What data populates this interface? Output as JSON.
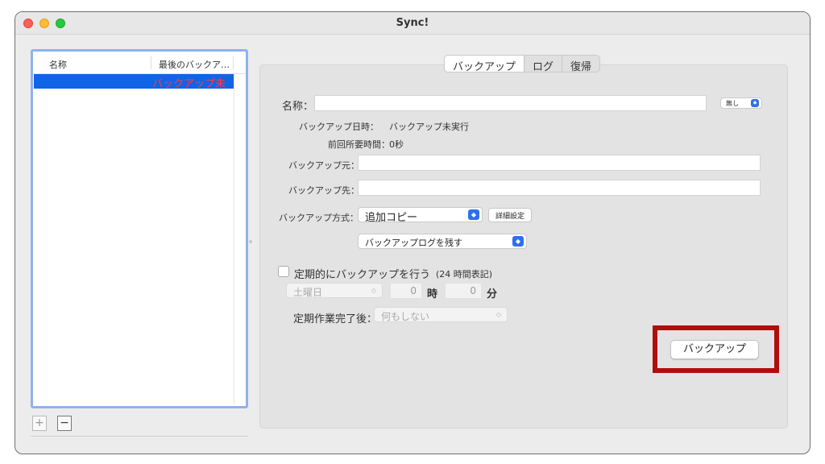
{
  "window": {
    "title": "Sync!"
  },
  "list": {
    "columns": [
      "名称",
      "最後のバックア…"
    ],
    "rows": [
      {
        "name": "",
        "status": "バックアップ未"
      }
    ],
    "add_label": "+",
    "remove_label": "−"
  },
  "tabs": [
    "バックアップ",
    "ログ",
    "復帰"
  ],
  "form": {
    "name_label": "名称：",
    "name_value": "",
    "name_option": "無し",
    "backup_datetime_label": "バックアップ日時：",
    "backup_datetime_value": "バックアップ未実行",
    "prev_duration_label": "前回所要時間：",
    "prev_duration_value": "0秒",
    "source_label": "バックアップ元：",
    "source_value": "",
    "dest_label": "バックアップ先：",
    "dest_value": "",
    "method_label": "バックアップ方式：",
    "method_value": "追加コピー",
    "detail_button": "詳細設定",
    "log_option": "バックアップログを残す",
    "schedule_checkbox_label": "定期的にバックアップを行う",
    "schedule_note": "(24 時間表記)",
    "weekday_value": "土曜日",
    "hour_value": "0",
    "hour_unit": "時",
    "minute_value": "0",
    "minute_unit": "分",
    "after_label": "定期作業完了後：",
    "after_value": "何もしない",
    "backup_button": "バックアップ"
  },
  "colors": {
    "selection": "#1064e6",
    "status_text": "#ff3b3b",
    "highlight": "#b20d0d",
    "accent": "#2f6ef0"
  }
}
